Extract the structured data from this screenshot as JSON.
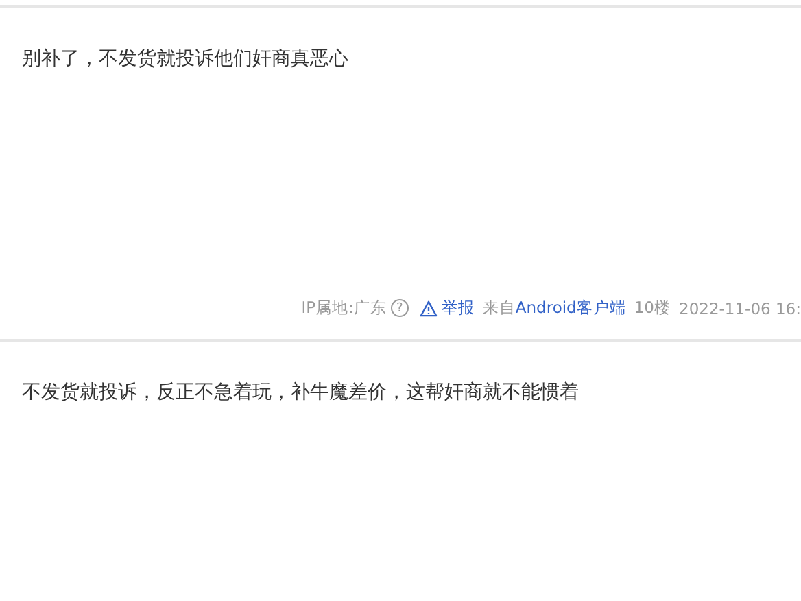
{
  "posts": [
    {
      "content": "别补了，不发货就投诉他们奸商真恶心",
      "meta": {
        "ip": "IP属地:广东",
        "help": "?",
        "report": "举报",
        "source_prefix": "来自",
        "source": "Android客户端",
        "floor": "10楼",
        "time": "2022-11-06 16:"
      }
    },
    {
      "content": "不发货就投诉，反正不急着玩，补牛魔差价，这帮奸商就不能惯着"
    }
  ]
}
